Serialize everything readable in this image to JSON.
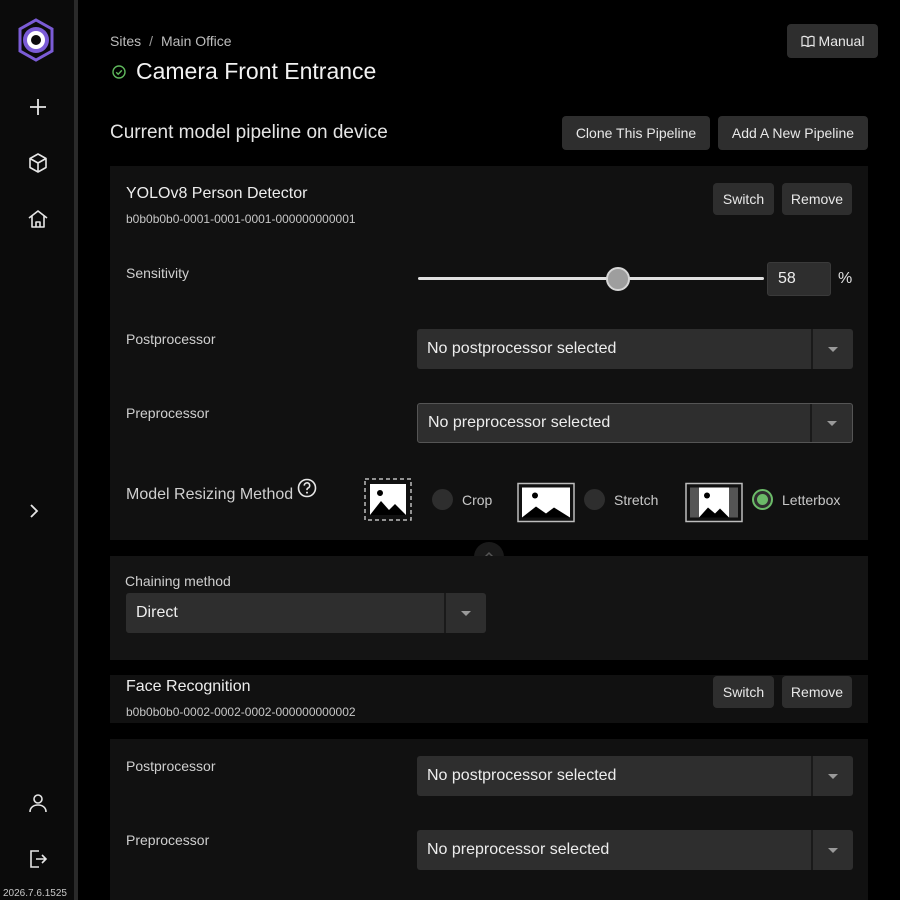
{
  "app": {
    "version": "2026.7.6.1525",
    "accent_color": "#7b5cd6",
    "radio_on_color": "#6bbb68"
  },
  "sidebar": {
    "items": [
      {
        "icon": "plus-icon"
      },
      {
        "icon": "cube-icon"
      },
      {
        "icon": "home-icon"
      },
      {
        "icon": "chevron-right-icon"
      },
      {
        "icon": "user-icon"
      },
      {
        "icon": "logout-icon"
      }
    ]
  },
  "breadcrumb": {
    "root": "Sites",
    "separator": "/",
    "current": "Main Office"
  },
  "header": {
    "title": "Camera Front Entrance",
    "manual_label": "Manual"
  },
  "pipeline": {
    "section_title": "Current model pipeline on device",
    "clone_label": "Clone This Pipeline",
    "add_label": "Add A New Pipeline"
  },
  "model1": {
    "name": "YOLOv8 Person Detector",
    "id": "b0b0b0b0-0001-0001-0001-000000000001",
    "switch_label": "Switch",
    "remove_label": "Remove",
    "sensitivity_label": "Sensitivity",
    "sensitivity_value": "58",
    "sensitivity_unit": "%",
    "postprocessor_label": "Postprocessor",
    "postprocessor_value": "No postprocessor selected",
    "preprocessor_label": "Preprocessor",
    "preprocessor_value": "No preprocessor selected",
    "resize_label": "Model Resizing Method",
    "resize_options": [
      "Crop",
      "Stretch",
      "Letterbox"
    ],
    "resize_selected": "Letterbox"
  },
  "chaining": {
    "label": "Chaining method",
    "value": "Direct"
  },
  "model2": {
    "name": "Face Recognition",
    "id": "b0b0b0b0-0002-0002-0002-000000000002",
    "switch_label": "Switch",
    "remove_label": "Remove",
    "postprocessor_label": "Postprocessor",
    "postprocessor_value": "No postprocessor selected",
    "preprocessor_label": "Preprocessor",
    "preprocessor_value": "No preprocessor selected"
  }
}
